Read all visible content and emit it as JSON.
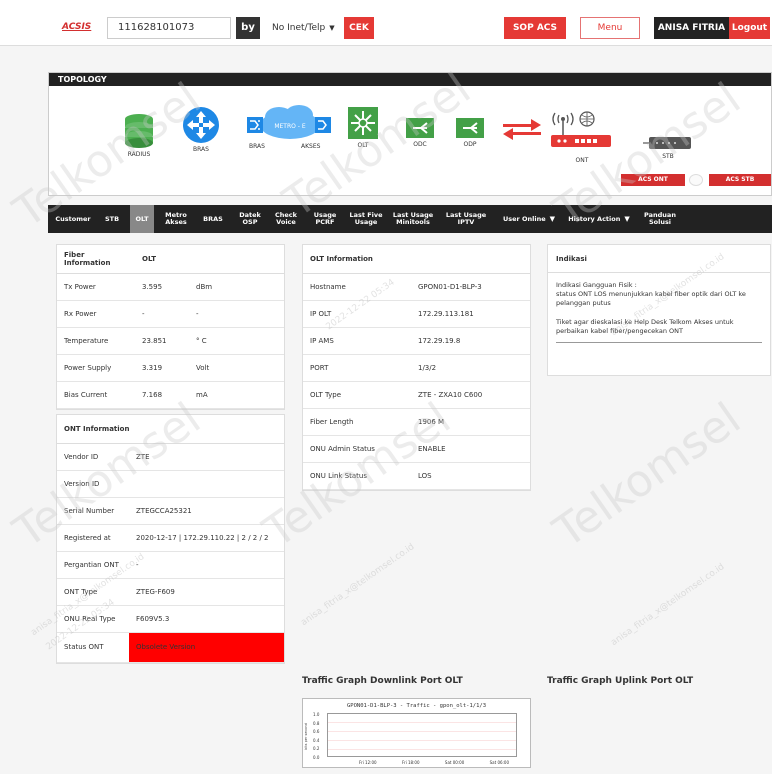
{
  "header": {
    "logo": "ACSIS",
    "account_value": "111628101073",
    "by_label": "by",
    "search_type": "No Inet/Telp",
    "cek_label": "CEK",
    "sop_label": "SOP ACS",
    "menu_label": "Menu",
    "user_name": "ANISA FITRIA",
    "logout_label": "Logout"
  },
  "topology": {
    "title": "TOPOLOGY",
    "nodes": {
      "radius": "RADIUS",
      "bras1": "BRAS",
      "bras2": "BRAS",
      "metro": "METRO - E",
      "akses": "AKSES",
      "olt": "OLT",
      "odc": "ODC",
      "odp": "ODP",
      "ont": "ONT",
      "stb": "STB"
    },
    "acs_ont": "ACS ONT Connectivity",
    "acs_stb": "ACS STB Connectivity"
  },
  "nav": [
    {
      "label": "Customer"
    },
    {
      "label": "STB"
    },
    {
      "label": "OLT"
    },
    {
      "label": "Metro Akses"
    },
    {
      "label": "BRAS"
    },
    {
      "label": "Datek OSP"
    },
    {
      "label": "Check Voice"
    },
    {
      "label": "Usage PCRF"
    },
    {
      "label": "Last Five Usage"
    },
    {
      "label": "Last Usage Minitools"
    },
    {
      "label": "Last Usage IPTV"
    },
    {
      "label": "User Online"
    },
    {
      "label": "History Action"
    },
    {
      "label": "Panduan Solusi"
    }
  ],
  "fiber": {
    "head": [
      "Fiber Information",
      "OLT",
      ""
    ],
    "rows": [
      [
        "Tx Power",
        "3.595",
        "dBm"
      ],
      [
        "Rx Power",
        "-",
        "-"
      ],
      [
        "Temperature",
        "23.851",
        "° C"
      ],
      [
        "Power Supply",
        "3.319",
        "Volt"
      ],
      [
        "Bias Current",
        "7.168",
        "mA"
      ]
    ]
  },
  "ont": {
    "head": "ONT Information",
    "rows": [
      [
        "Vendor ID",
        "ZTE"
      ],
      [
        "Version ID",
        ""
      ],
      [
        "Serial Number",
        "ZTEGCCA25321"
      ],
      [
        "Registered at",
        "2020-12-17 | 172.29.110.22 | 2 / 2 / 2"
      ],
      [
        "Pergantian ONT",
        "-"
      ],
      [
        "ONT Type",
        "ZTEG-F609"
      ],
      [
        "ONU Real Type",
        "F609V5.3"
      ],
      [
        "Status ONT",
        "Obsolete Version"
      ]
    ]
  },
  "olt": {
    "head": "OLT Information",
    "rows": [
      [
        "Hostname",
        "GPON01-D1-BLP-3"
      ],
      [
        "IP OLT",
        "172.29.113.181"
      ],
      [
        "IP AMS",
        "172.29.19.8"
      ],
      [
        "PORT",
        "1/3/2"
      ],
      [
        "OLT Type",
        "ZTE - ZXA10 C600"
      ],
      [
        "Fiber Length",
        "1906 M"
      ],
      [
        "ONU Admin Status",
        "ENABLE"
      ],
      [
        "ONU Link Status",
        "LOS"
      ]
    ]
  },
  "indikasi": {
    "head": "Indikasi",
    "line1": "Indikasi Gangguan Fisik :",
    "line2": "status ONT LOS menunjukkan kabel fiber optik dari OLT ke pelanggan putus",
    "line3": "Tiket agar dieskalasi ke Help Desk Telkom Akses untuk perbaikan kabel fiber/pengecekan ONT"
  },
  "graphs": {
    "downlink_title": "Traffic Graph Downlink Port OLT",
    "uplink_title": "Traffic Graph Uplink Port OLT",
    "downlink_inner_title": "GPON01-D1-BLP-3 - Traffic - gpon_olt-1/1/3",
    "y_ticks": [
      "1.0",
      "0.8",
      "0.6",
      "0.4",
      "0.2",
      "0.0"
    ],
    "x_ticks": [
      "Fri 12:00",
      "Fri 18:00",
      "Sat 00:00",
      "Sat 06:00"
    ],
    "ylabel": "bits per second"
  },
  "watermark": {
    "text": "anisa_fitria_x@telkomsel.co.id",
    "date": "2022-12-22 05:34",
    "brand": "Telkomsel"
  },
  "colors": {
    "accent": "#e53935",
    "dark": "#222222",
    "status_red": "#ff0000"
  }
}
